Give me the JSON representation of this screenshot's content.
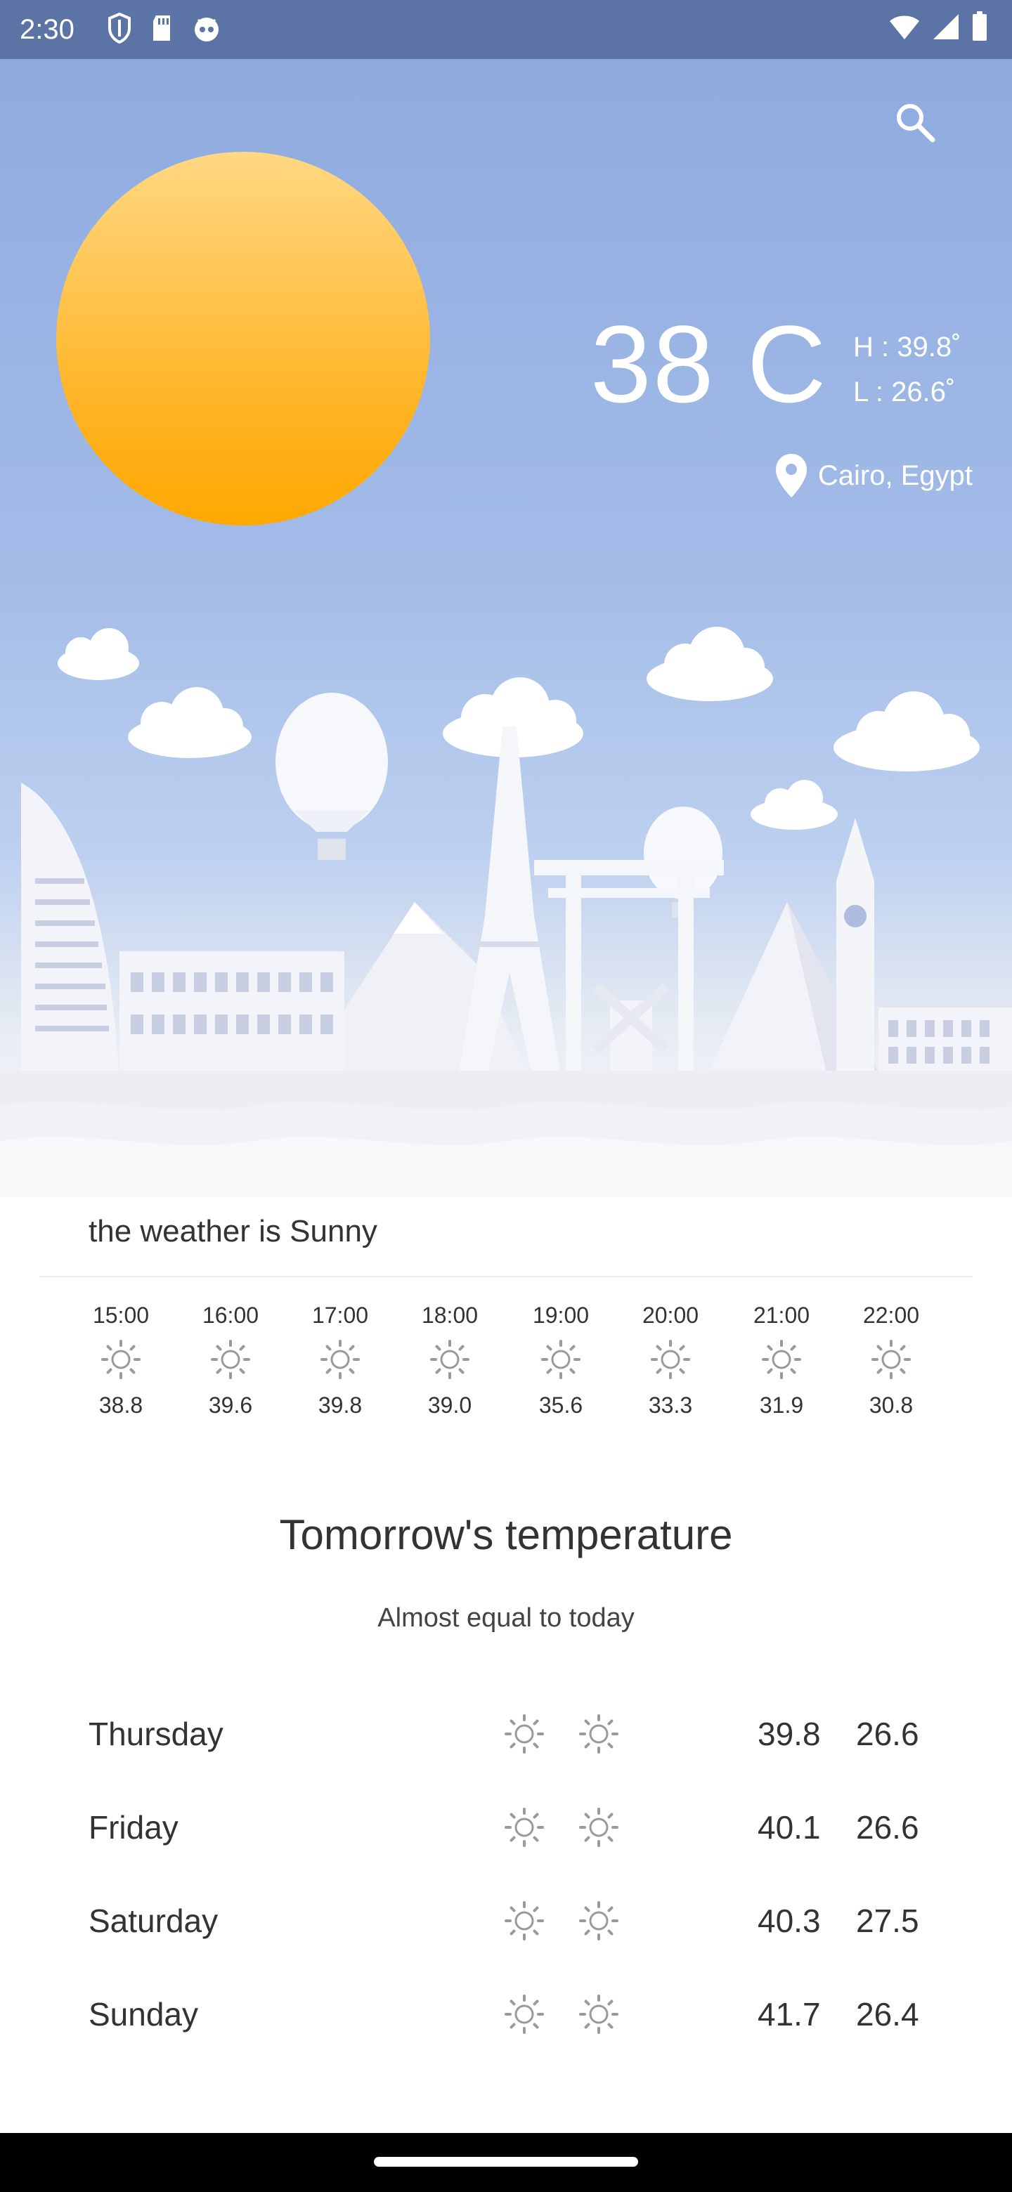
{
  "status_bar": {
    "time": "2:30"
  },
  "current": {
    "temp": "38 C",
    "high": "H : 39.8˚",
    "low": "L  : 26.6˚",
    "location": "Cairo, Egypt",
    "condition_text": "the weather is Sunny"
  },
  "hourly": [
    {
      "time": "15:00",
      "temp": "38.8",
      "icon": "sun-icon"
    },
    {
      "time": "16:00",
      "temp": "39.6",
      "icon": "sun-icon"
    },
    {
      "time": "17:00",
      "temp": "39.8",
      "icon": "sun-icon"
    },
    {
      "time": "18:00",
      "temp": "39.0",
      "icon": "sun-icon"
    },
    {
      "time": "19:00",
      "temp": "35.6",
      "icon": "sun-icon"
    },
    {
      "time": "20:00",
      "temp": "33.3",
      "icon": "sun-icon"
    },
    {
      "time": "21:00",
      "temp": "31.9",
      "icon": "sun-icon"
    },
    {
      "time": "22:00",
      "temp": "30.8",
      "icon": "sun-icon"
    }
  ],
  "tomorrow": {
    "title": "Tomorrow's temperature",
    "subtitle": "Almost equal to today"
  },
  "daily": [
    {
      "day": "Thursday",
      "high": "39.8",
      "low": "26.6"
    },
    {
      "day": "Friday",
      "high": "40.1",
      "low": "26.6"
    },
    {
      "day": "Saturday",
      "high": "40.3",
      "low": "27.5"
    },
    {
      "day": "Sunday",
      "high": "41.7",
      "low": "26.4"
    }
  ],
  "colors": {
    "status_bar": "#5c73a5",
    "sky": "#8eaadf",
    "sun": "#ffb322",
    "text": "#333333"
  }
}
